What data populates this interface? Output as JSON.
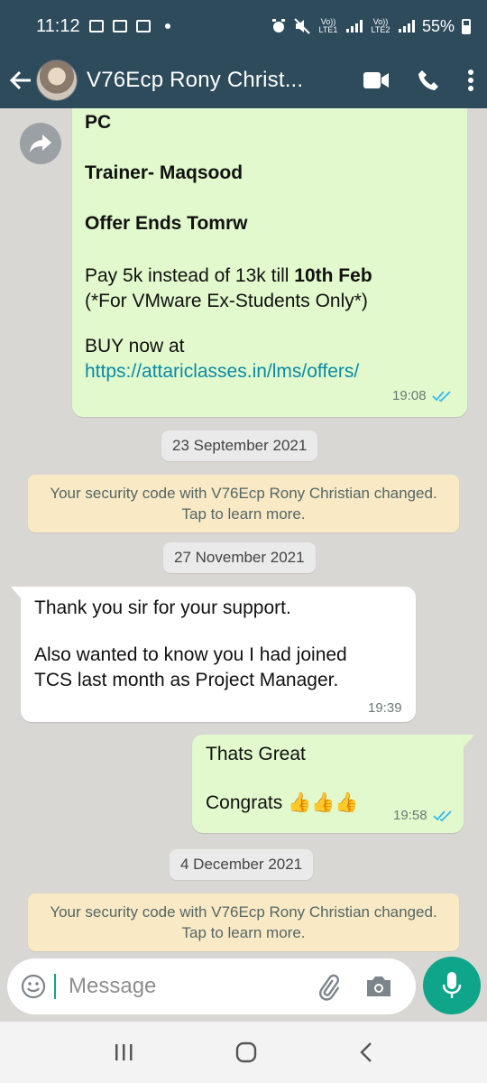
{
  "status_bar": {
    "time": "11:12",
    "battery": "55%",
    "sim1_label": "Vo)) LTE1",
    "sim2_label": "Vo)) LTE2"
  },
  "header": {
    "contact_name": "V76Ecp Rony Christ...",
    "icons": [
      "back-arrow-icon",
      "video-call-icon",
      "phone-icon",
      "more-vert-icon"
    ]
  },
  "messages": {
    "offer": {
      "line_pc": "PC",
      "trainer": "Trainer- Maqsood",
      "offer_ends": "Offer Ends Tomrw",
      "pay_text": "Pay 5k instead of 13k till ",
      "pay_bold": "10th Feb",
      "note": "(*For VMware Ex-Students Only*)",
      "buy": "BUY now at",
      "link": "https://attariclasses.in/lms/offers/",
      "time": "19:08"
    },
    "date1": "23 September 2021",
    "security1_line1": "Your security code with V76Ecp Rony Christian changed.",
    "security1_line2": "Tap to learn more.",
    "date2": "27 November 2021",
    "incoming": {
      "line1": "Thank you sir for your support.",
      "line2": "Also wanted to know you I had joined",
      "line3": "TCS last month as Project Manager.",
      "time": "19:39"
    },
    "outgoing": {
      "line1": "Thats Great",
      "line2": "Congrats 👍👍👍",
      "time": "19:58"
    },
    "date3": "4 December 2021",
    "security2_line1": "Your security code with V76Ecp Rony Christian changed.",
    "security2_line2": "Tap to learn more."
  },
  "composer": {
    "placeholder": "Message"
  },
  "colors": {
    "header_bg": "#2e4b5c",
    "outgoing_bubble": "#e1f9cc",
    "incoming_bubble": "#ffffff",
    "system_bubble": "#f9eac5",
    "mic_button": "#0fa58a",
    "link": "#0a8aa6",
    "read_ticks": "#34b7f1"
  }
}
